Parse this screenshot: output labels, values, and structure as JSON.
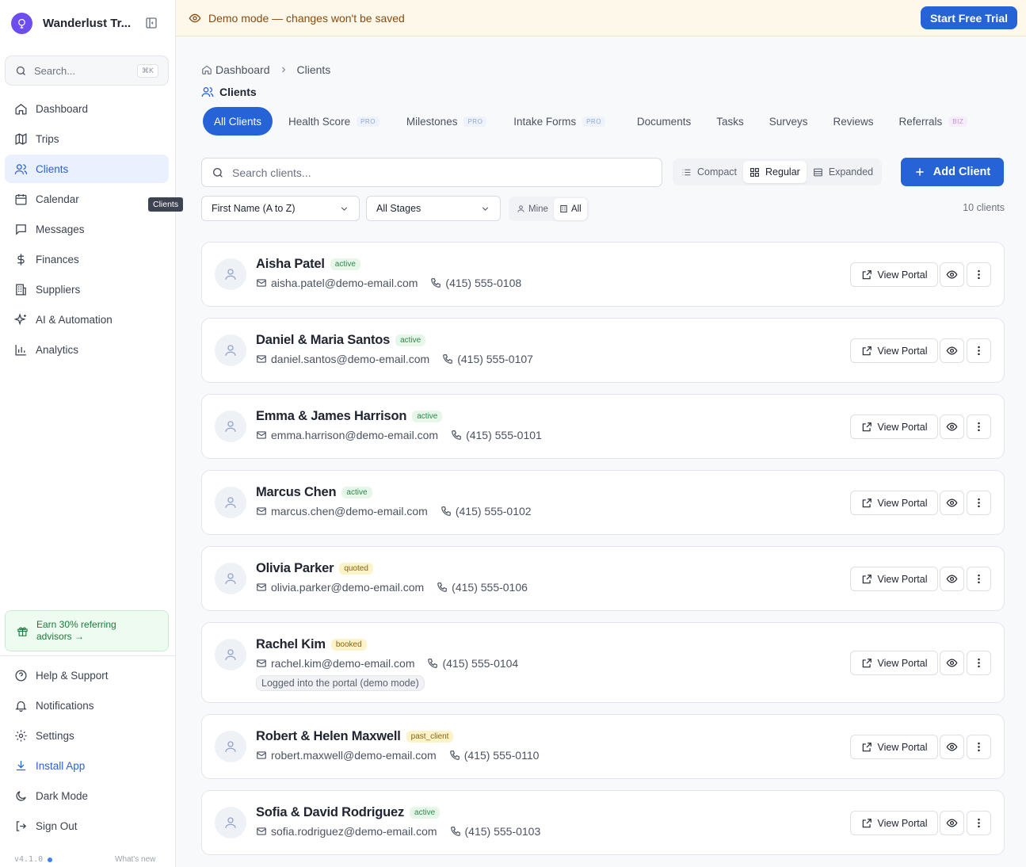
{
  "app": {
    "name": "Wanderlust Tr...",
    "version": "v4.1.0",
    "whats_new": "What's new"
  },
  "sidebar": {
    "search_placeholder": "Search...",
    "search_shortcut": "⌘K",
    "items": [
      {
        "label": "Dashboard",
        "icon": "home-icon"
      },
      {
        "label": "Trips",
        "icon": "map-icon"
      },
      {
        "label": "Clients",
        "icon": "users-icon",
        "active": true
      },
      {
        "label": "Calendar",
        "icon": "calendar-icon"
      },
      {
        "label": "Messages",
        "icon": "message-icon"
      },
      {
        "label": "Finances",
        "icon": "dollar-icon"
      },
      {
        "label": "Suppliers",
        "icon": "building-icon"
      },
      {
        "label": "AI & Automation",
        "icon": "sparkles-icon"
      },
      {
        "label": "Analytics",
        "icon": "bar-chart-icon"
      }
    ],
    "tooltip": "Clients",
    "promo": "Earn 30% referring advisors →",
    "bottom_items": [
      {
        "label": "Help & Support",
        "icon": "help-icon"
      },
      {
        "label": "Notifications",
        "icon": "bell-icon"
      },
      {
        "label": "Settings",
        "icon": "gear-icon"
      },
      {
        "label": "Install App",
        "icon": "download-icon"
      },
      {
        "label": "Dark Mode",
        "icon": "moon-icon"
      },
      {
        "label": "Sign Out",
        "icon": "sign-out-icon"
      }
    ]
  },
  "banner": {
    "text": "Demo mode — changes won't be saved",
    "cta": "Start Free Trial"
  },
  "breadcrumb": {
    "home": "Dashboard",
    "current": "Clients"
  },
  "page_title": "Clients",
  "tabs": [
    {
      "label": "All Clients",
      "active": true
    },
    {
      "label": "Health Score",
      "badge": "PRO"
    },
    {
      "label": "Milestones",
      "badge": "PRO"
    },
    {
      "label": "Intake Forms",
      "badge": "PRO"
    },
    {
      "label": "Documents"
    },
    {
      "label": "Tasks"
    },
    {
      "label": "Surveys"
    },
    {
      "label": "Reviews"
    },
    {
      "label": "Referrals",
      "badge": "BIZ"
    }
  ],
  "toolbar": {
    "search_placeholder": "Search clients...",
    "density": {
      "compact": "Compact",
      "regular": "Regular",
      "expanded": "Expanded",
      "selected": "Regular"
    },
    "add_label": "Add Client",
    "sort_value": "First Name (A to Z)",
    "stage_value": "All Stages",
    "owner_mine": "Mine",
    "owner_all": "All",
    "count": "10 clients"
  },
  "clients": [
    {
      "name": "Aisha Patel",
      "stage": "active",
      "email": "aisha.patel@demo-email.com",
      "phone": "(415) 555-0108"
    },
    {
      "name": "Daniel & Maria Santos",
      "stage": "active",
      "email": "daniel.santos@demo-email.com",
      "phone": "(415) 555-0107"
    },
    {
      "name": "Emma & James Harrison",
      "stage": "active",
      "email": "emma.harrison@demo-email.com",
      "phone": "(415) 555-0101"
    },
    {
      "name": "Marcus Chen",
      "stage": "active",
      "email": "marcus.chen@demo-email.com",
      "phone": "(415) 555-0102"
    },
    {
      "name": "Olivia Parker",
      "stage": "quoted",
      "email": "olivia.parker@demo-email.com",
      "phone": "(415) 555-0106"
    },
    {
      "name": "Rachel Kim",
      "stage": "booked",
      "email": "rachel.kim@demo-email.com",
      "phone": "(415) 555-0104",
      "note": "Logged into the portal (demo mode)"
    },
    {
      "name": "Robert & Helen Maxwell",
      "stage": "past_client",
      "email": "robert.maxwell@demo-email.com",
      "phone": "(415) 555-0110"
    },
    {
      "name": "Sofia & David Rodriguez",
      "stage": "active",
      "email": "sofia.rodriguez@demo-email.com",
      "phone": "(415) 555-0103"
    }
  ],
  "card_actions": {
    "view_portal": "View Portal"
  },
  "colors": {
    "accent": "#2563d6",
    "active_stage": "#2b8a4a",
    "warn_stage": "#8a6410",
    "banner_bg": "#fdf8ea"
  }
}
